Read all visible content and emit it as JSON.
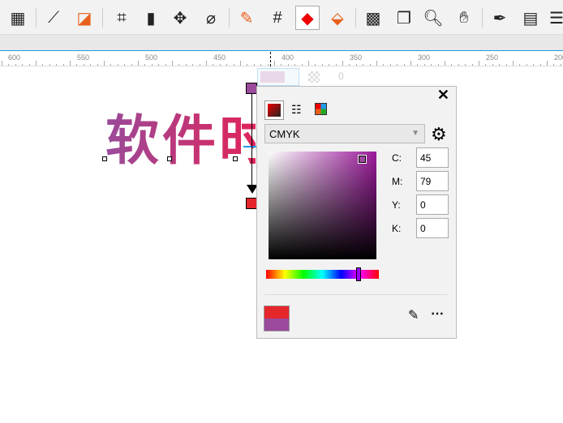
{
  "toolbar": {
    "icons": [
      "table-icon",
      "dimension-icon",
      "connector-icon",
      "crop-icon",
      "eraser-icon",
      "transform-icon",
      "blend-icon",
      "eyedropper-icon",
      "grid-snap-icon",
      "interactive-fill-icon",
      "smart-fill-icon",
      "transparency-icon",
      "drop-shadow-icon",
      "zoom-icon",
      "pan-icon",
      "pen-icon",
      "fill-properties-icon",
      "align-icon"
    ]
  },
  "ruler": {
    "labels": [
      "600",
      "550",
      "500",
      "450",
      "400",
      "350",
      "300",
      "250",
      "200"
    ]
  },
  "canvas": {
    "text": "软件时"
  },
  "property_bar": {
    "transparency_value": "0"
  },
  "picker": {
    "model": "CMYK",
    "labels": {
      "c": "C:",
      "m": "M:",
      "y": "Y:",
      "k": "K:"
    },
    "values": {
      "c": "45",
      "m": "79",
      "y": "0",
      "k": "0"
    },
    "new_color": "#e5262b",
    "old_color": "#9b4a9c"
  }
}
